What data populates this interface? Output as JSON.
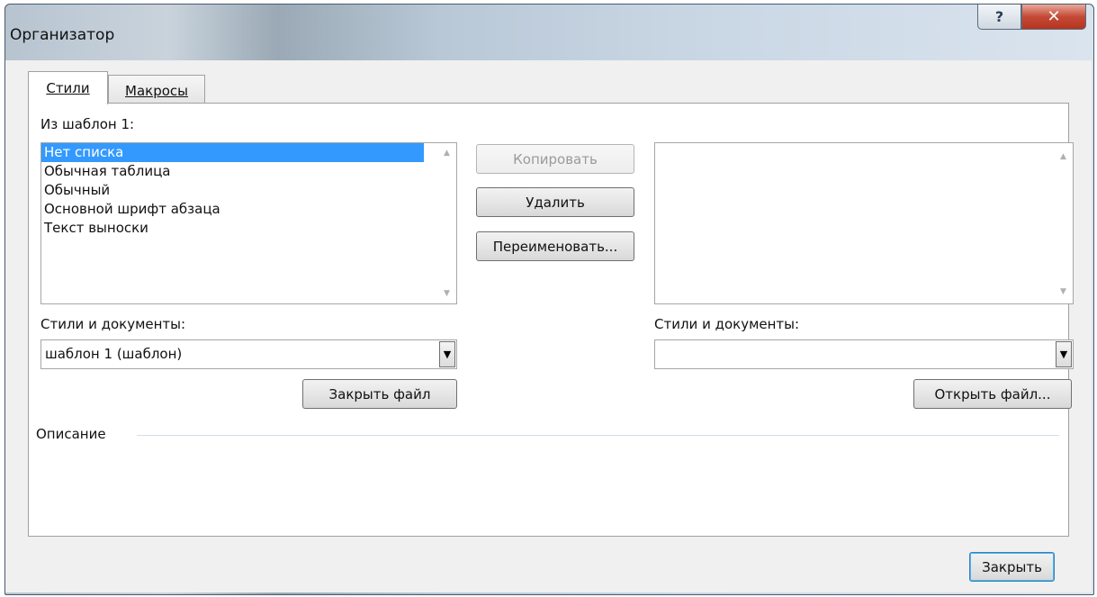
{
  "window": {
    "title": "Организатор"
  },
  "titlebar": {
    "help_glyph": "?",
    "close_glyph": "✕"
  },
  "tabs": [
    {
      "label": "Стили",
      "selected": true
    },
    {
      "label": "Макросы",
      "selected": false
    }
  ],
  "left": {
    "from_label": "Из шаблон 1:",
    "items": [
      "Нет списка",
      "Обычная таблица",
      "Обычный",
      "Основной шрифт абзаца",
      "Текст выноски"
    ],
    "selected_index": 0,
    "styles_docs_label": "Стили и документы:",
    "combo_value": "шаблон 1 (шаблон)",
    "close_file_button": "Закрыть файл"
  },
  "middle": {
    "copy_button": "Копировать",
    "delete_button": "Удалить",
    "rename_button": "Переименовать..."
  },
  "right": {
    "styles_docs_label": "Стили и документы:",
    "combo_value": "",
    "open_file_button": "Открыть файл..."
  },
  "description": {
    "label": "Описание"
  },
  "footer": {
    "close_button": "Закрыть"
  },
  "icons": {
    "scroll_up": "chevron-up-icon",
    "scroll_down": "chevron-down-icon",
    "dropdown": "triangle-down-icon"
  }
}
